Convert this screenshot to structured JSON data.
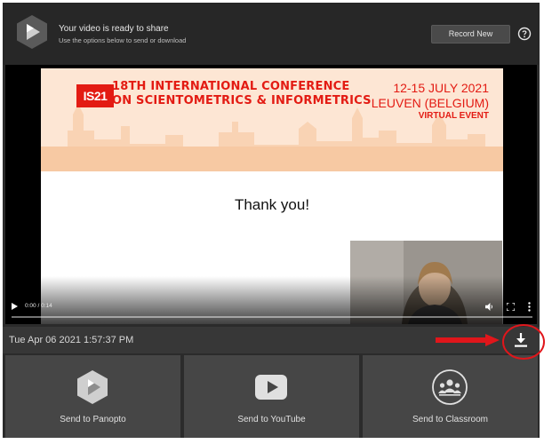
{
  "header": {
    "title": "Your video is ready to share",
    "subtitle": "Use the options below to send or download",
    "record_label": "Record New"
  },
  "slide": {
    "logo_text": "IS21",
    "conference_line1": "18TH INTERNATIONAL CONFERENCE",
    "conference_line2": "ON SCIENTOMETRICS & INFORMETRICS",
    "dates": "12-15 JULY 2021",
    "location": "LEUVEN (BELGIUM)",
    "event_type": "VIRTUAL EVENT",
    "thank_you": "Thank you!"
  },
  "player": {
    "time": "0:00 / 0:14",
    "progress": 0
  },
  "timestamp": "Tue Apr 06 2021 1:57:37 PM",
  "share": [
    {
      "label": "Send to Panopto",
      "icon": "panopto-icon"
    },
    {
      "label": "Send to YouTube",
      "icon": "youtube-icon"
    },
    {
      "label": "Send to Classroom",
      "icon": "classroom-icon"
    }
  ],
  "colors": {
    "accent_red": "#e31b13",
    "annotation_red": "#e0161b",
    "panel_bg": "#2b2b2b"
  }
}
